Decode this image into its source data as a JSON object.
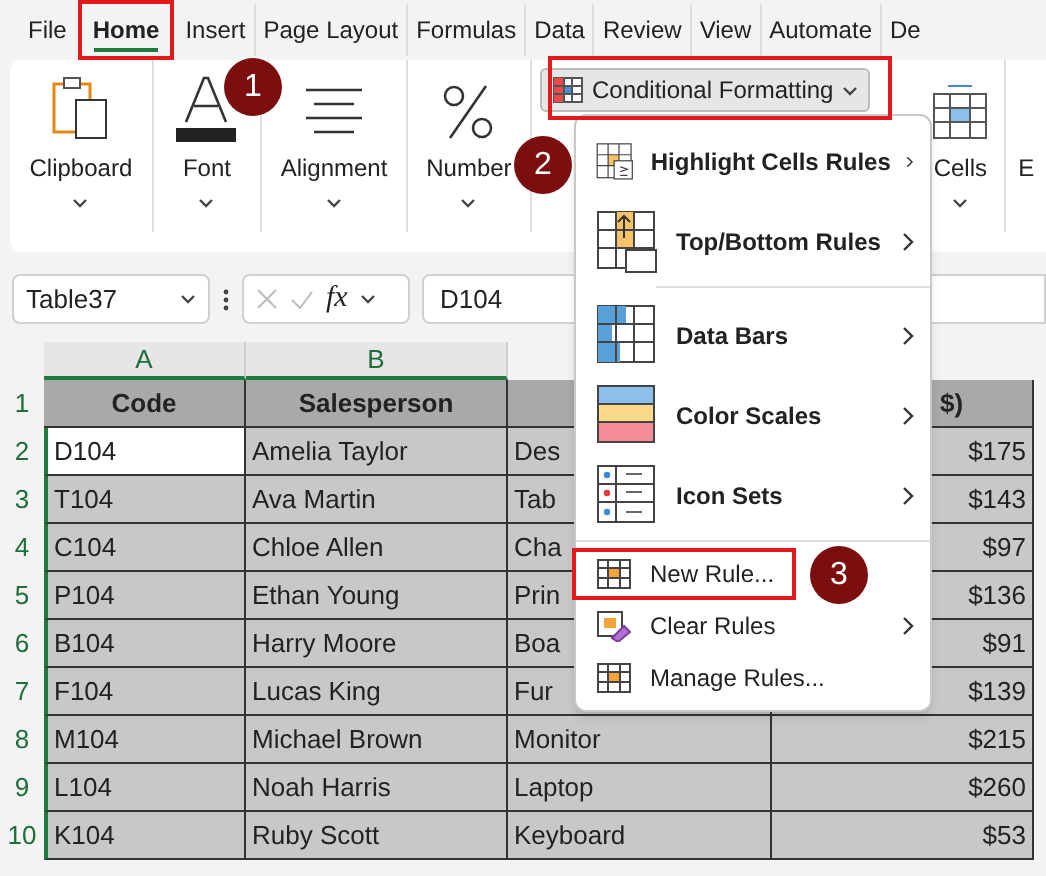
{
  "tabs": [
    {
      "label": "File",
      "selected": false
    },
    {
      "label": "Home",
      "selected": true
    },
    {
      "label": "Insert",
      "selected": false
    },
    {
      "label": "Page Layout",
      "selected": false
    },
    {
      "label": "Formulas",
      "selected": false
    },
    {
      "label": "Data",
      "selected": false
    },
    {
      "label": "Review",
      "selected": false
    },
    {
      "label": "View",
      "selected": false
    },
    {
      "label": "Automate",
      "selected": false
    },
    {
      "label": "De",
      "selected": false
    }
  ],
  "ribbon": {
    "groups_left": [
      {
        "label": "Clipboard"
      },
      {
        "label": "Font"
      },
      {
        "label": "Alignment"
      },
      {
        "label": "Number"
      }
    ],
    "conditional_formatting": {
      "label": "Conditional Formatting",
      "expanded": true
    },
    "groups_right": [
      {
        "label": "Cells"
      },
      {
        "label": "E"
      }
    ]
  },
  "formula_bar": {
    "name_box": "Table37",
    "fx": "fx",
    "formula": "D104"
  },
  "sheet": {
    "column_headers": [
      "A",
      "B"
    ],
    "header_row": {
      "number": "1",
      "cells": [
        "Code",
        "Salesperson",
        "",
        "$)"
      ]
    },
    "rows": [
      {
        "number": "2",
        "active": true,
        "cells": [
          "D104",
          "Amelia Taylor",
          "Des",
          "$175"
        ]
      },
      {
        "number": "3",
        "active": false,
        "cells": [
          "T104",
          "Ava Martin",
          "Tab",
          "$143"
        ]
      },
      {
        "number": "4",
        "active": false,
        "cells": [
          "C104",
          "Chloe Allen",
          "Cha",
          "$97"
        ]
      },
      {
        "number": "5",
        "active": false,
        "cells": [
          "P104",
          "Ethan Young",
          "Prin",
          "$136"
        ]
      },
      {
        "number": "6",
        "active": false,
        "cells": [
          "B104",
          "Harry Moore",
          "Boa",
          "$91"
        ]
      },
      {
        "number": "7",
        "active": false,
        "cells": [
          "F104",
          "Lucas King",
          "Fur",
          "$139"
        ]
      },
      {
        "number": "8",
        "active": false,
        "cells": [
          "M104",
          "Michael Brown",
          "Monitor",
          "$215"
        ]
      },
      {
        "number": "9",
        "active": false,
        "cells": [
          "L104",
          "Noah Harris",
          "Laptop",
          "$260"
        ]
      },
      {
        "number": "10",
        "active": false,
        "cells": [
          "K104",
          "Ruby Scott",
          "Keyboard",
          "$53"
        ]
      }
    ]
  },
  "menu": {
    "sections": [
      [
        {
          "label": "Highlight Cells Rules",
          "kind": "large",
          "submenu": true
        },
        {
          "label": "Top/Bottom Rules",
          "kind": "large",
          "submenu": true
        }
      ],
      [
        {
          "label": "Data Bars",
          "kind": "large",
          "submenu": true
        },
        {
          "label": "Color Scales",
          "kind": "large",
          "submenu": true
        },
        {
          "label": "Icon Sets",
          "kind": "large",
          "submenu": true
        }
      ],
      [
        {
          "label": "New Rule...",
          "kind": "small",
          "submenu": false
        },
        {
          "label": "Clear Rules",
          "kind": "small",
          "submenu": true
        },
        {
          "label": "Manage Rules...",
          "kind": "small",
          "submenu": false
        }
      ]
    ]
  },
  "callouts": [
    {
      "label": "1"
    },
    {
      "label": "2"
    },
    {
      "label": "3"
    }
  ]
}
